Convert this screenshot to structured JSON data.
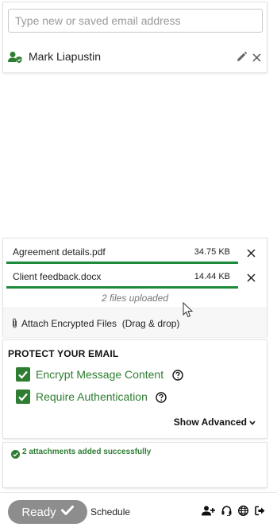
{
  "recipients": {
    "input_placeholder": "Type new or saved email address",
    "input_value": "",
    "list": [
      {
        "name": "Mark Liapustin",
        "icon": "verified-user-icon"
      }
    ]
  },
  "attachments": {
    "files": [
      {
        "name": "Agreement details.pdf",
        "size": "34.75 KB",
        "progress": 1.0
      },
      {
        "name": "Client feedback.docx",
        "size": "14.44 KB",
        "progress": 1.0
      }
    ],
    "status": "2 files uploaded",
    "attach_label": "Attach Encrypted Files  (Drag & drop)"
  },
  "protect": {
    "title": "PROTECT YOUR EMAIL",
    "options": [
      {
        "label": "Encrypt Message Content",
        "checked": true
      },
      {
        "label": "Require Authentication",
        "checked": true
      }
    ],
    "show_advanced": "Show Advanced"
  },
  "notice": {
    "text": "2 attachments added successfully"
  },
  "footer": {
    "ready_label": "Ready",
    "schedule_label": "Schedule",
    "icons": [
      "add-user-icon",
      "support-headset-icon",
      "globe-icon",
      "sign-out-icon"
    ]
  },
  "colors": {
    "accent_green": "#2e7d32",
    "progress_green": "#1d8a3c",
    "ready_gray": "#8d8d8d"
  }
}
